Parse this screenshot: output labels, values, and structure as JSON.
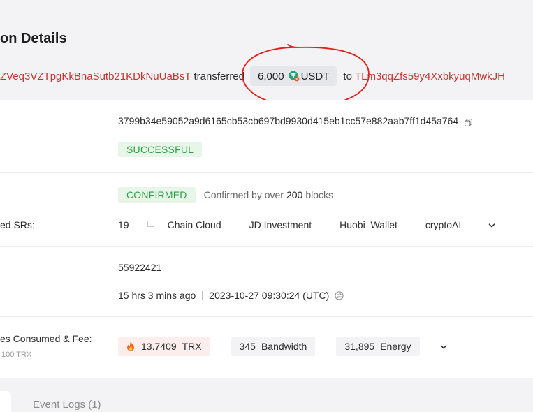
{
  "header": {
    "title_partial": "on Details",
    "from_address": "ZVeq3VZTpgKkBnaSutb21KDkNuUaBsT",
    "transferred_word": "transferred",
    "amount": "6,000",
    "token": "USDT",
    "to_word": "to",
    "to_address": "TLm3qqZfs59y4XxbkyuqMwkJH"
  },
  "hash_section": {
    "hash": "3799b34e59052a9d6165cb53cb697bd9930d415eb1cc57e882aab7ff1d45a764",
    "status": "SUCCESSFUL"
  },
  "confirm_section": {
    "status": "CONFIRMED",
    "confirm_text_prefix": "Confirmed by over",
    "confirm_count": "200",
    "confirm_text_suffix": "blocks",
    "srs_label": "ed SRs:",
    "srs_count": "19",
    "srs": [
      "Chain Cloud",
      "JD Investment",
      "Huobi_Wallet",
      "cryptoAI"
    ]
  },
  "block_section": {
    "block": "55922421",
    "age": "15 hrs 3 mins ago",
    "timestamp": "2023-10-27 09:30:24 (UTC)"
  },
  "fee_section": {
    "label": "es Consumed & Fee:",
    "sublabel": "100 TRX",
    "trx_amount": "13.7409",
    "trx_unit": "TRX",
    "bandwidth_amount": "345",
    "bandwidth_unit": "Bandwidth",
    "energy_amount": "31,895",
    "energy_unit": "Energy"
  },
  "tabs": {
    "event_logs": "Event Logs (1)"
  },
  "colors": {
    "address_red": "#c23631",
    "success_green": "#2f9e48",
    "tether_teal": "#26a17b",
    "annotation_red": "#e0201b"
  },
  "icons": {
    "usdt": "tether-icon",
    "copy": "copy-icon",
    "expand": "chevron-down-icon",
    "clock": "clock-icon",
    "fee": "flame-icon"
  }
}
